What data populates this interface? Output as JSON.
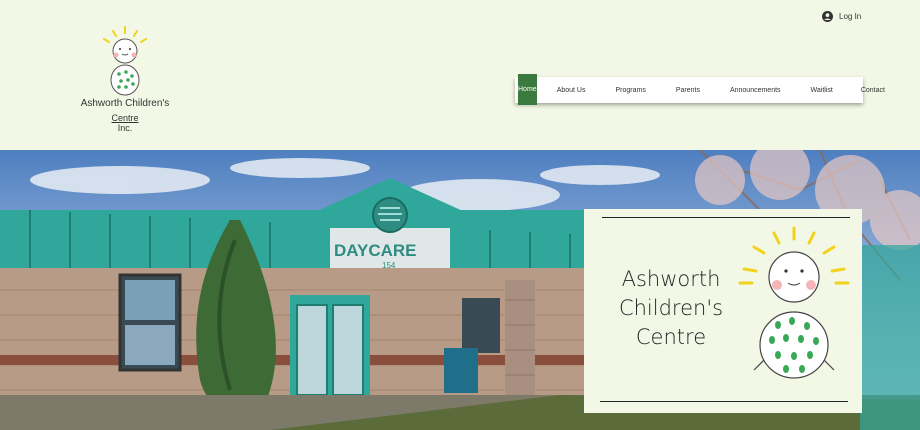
{
  "header": {
    "logo_line1": "Ashworth Children's",
    "logo_line2": "Centre",
    "logo_line3": "Inc.",
    "login_label": "Log In"
  },
  "nav": {
    "items": [
      {
        "label": "Home",
        "active": true
      },
      {
        "label": "About Us"
      },
      {
        "label": "Programs"
      },
      {
        "label": "Parents"
      },
      {
        "label": "Announcements"
      },
      {
        "label": "Waitlist"
      },
      {
        "label": "Contact"
      }
    ]
  },
  "hero": {
    "sign_text": "DAYCARE",
    "sign_number": "154",
    "card_line1": "Ashworth",
    "card_line2": "Children's",
    "card_line3": "Centre"
  },
  "colors": {
    "background": "#f2f8e5",
    "nav_active": "#3b7a3f",
    "teal_roof": "#2fa79a",
    "brick": "#b89b86"
  }
}
